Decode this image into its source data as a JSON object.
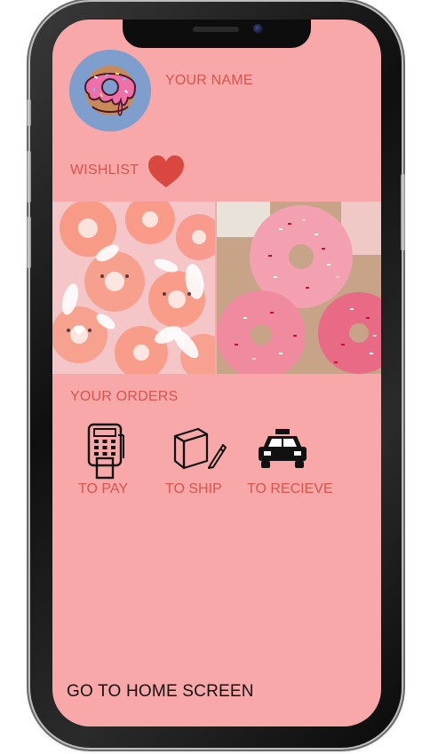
{
  "profile": {
    "name_label": "YOUR NAME"
  },
  "wishlist": {
    "label": "WISHLIST"
  },
  "orders": {
    "title": "YOUR ORDERS",
    "items": [
      {
        "label": "TO PAY",
        "icon": "card-terminal-icon"
      },
      {
        "label": "TO SHIP",
        "icon": "package-icon"
      },
      {
        "label": "TO RECIEVE",
        "icon": "taxi-icon"
      }
    ]
  },
  "footer": {
    "home_label": "GO TO HOME SCREEN"
  },
  "colors": {
    "background": "#f8a8a8",
    "accent": "#d9534f",
    "heart": "#d9483f",
    "avatar_bg": "#7e9fce"
  }
}
